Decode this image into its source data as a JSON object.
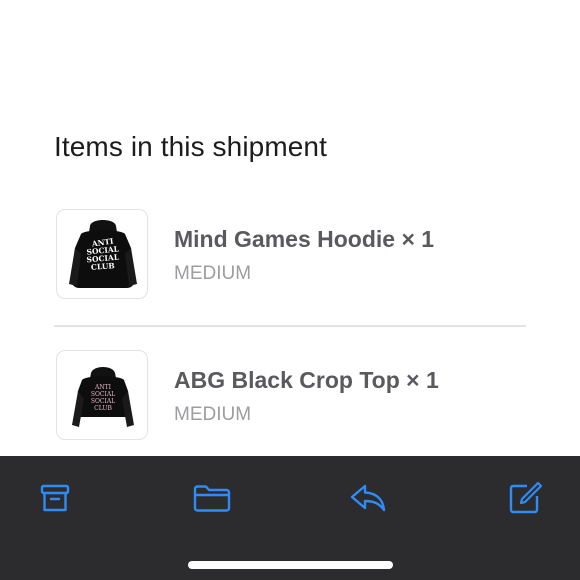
{
  "section": {
    "title": "Items in this shipment"
  },
  "items": [
    {
      "name": "Mind Games Hoodie × 1",
      "variant": "MEDIUM",
      "image": "black-hoodie-thumbnail",
      "print_text": [
        "ANTI",
        "SOCIAL",
        "SOCIAL",
        "CLUB"
      ]
    },
    {
      "name": "ABG Black Crop Top × 1",
      "variant": "MEDIUM",
      "image": "black-crop-hoodie-thumbnail",
      "print_text": [
        "ANTI",
        "SOCIAL",
        "SOCIAL",
        "CLUB"
      ]
    }
  ],
  "toolbar": {
    "icons": [
      "archive-icon",
      "folder-icon",
      "reply-icon",
      "compose-icon"
    ],
    "icon_color": "#2f8cf5",
    "background": "#2c2c2e"
  }
}
